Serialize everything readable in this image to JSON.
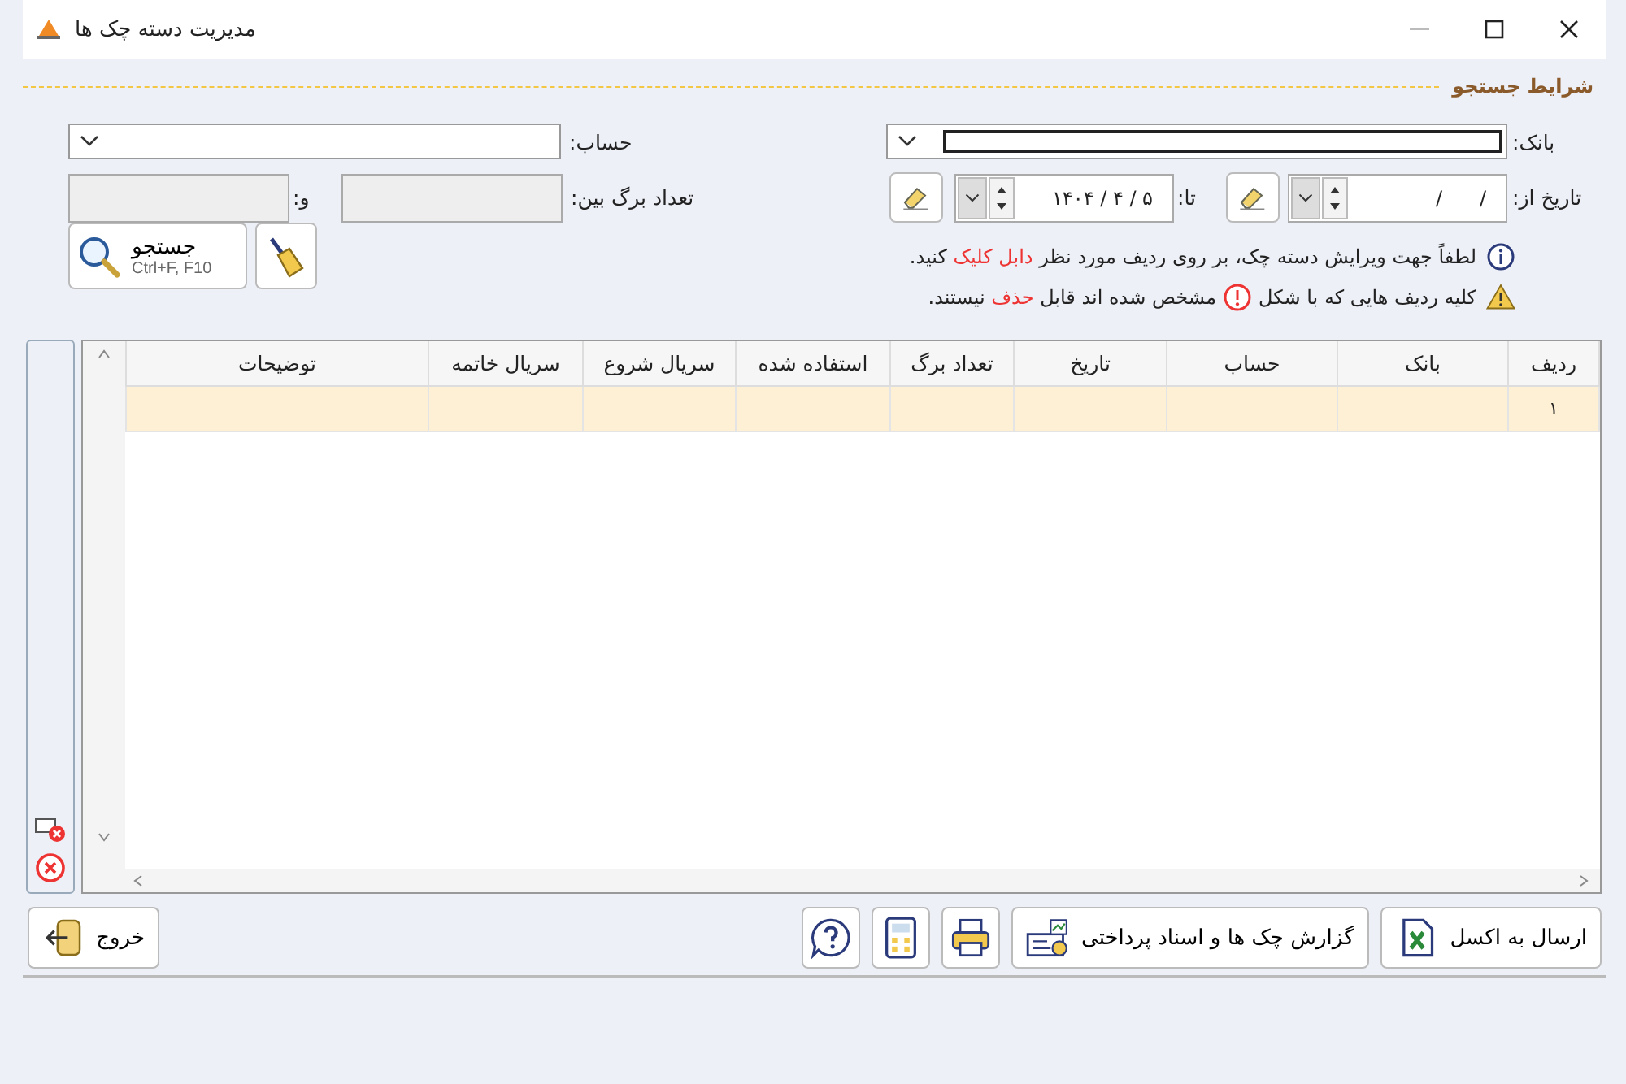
{
  "window": {
    "title": "مدیریت دسته چک ها"
  },
  "search_section": {
    "title": "شرایط جستجو",
    "bank": {
      "label": "بانک:"
    },
    "account": {
      "label": "حساب:"
    },
    "date_from": {
      "label": "تاریخ از:",
      "value": "/      /"
    },
    "date_to": {
      "label": "تا:",
      "value": "۱۴۰۴ / ۴ / ۵"
    },
    "sheet_count": {
      "label": "تعداد برگ بین:",
      "and_label": "و:"
    },
    "notes": [
      {
        "kind": "info",
        "parts": [
          {
            "kind": "text",
            "text": "لطفاً جهت ویرایش دسته چک، بر روی ردیف مورد نظر "
          },
          {
            "kind": "highlight",
            "text": "دابل کلیک"
          },
          {
            "kind": "text",
            "text": " کنید."
          }
        ]
      },
      {
        "kind": "warning",
        "parts": [
          {
            "kind": "text",
            "text": "کلیه ردیف هایی که با شکل"
          },
          {
            "kind": "icon"
          },
          {
            "kind": "text",
            "text": "مشخص شده اند قابل "
          },
          {
            "kind": "highlight",
            "text": "حذف"
          },
          {
            "kind": "text",
            "text": " نیستند."
          }
        ]
      }
    ],
    "search_button": {
      "label": "جستجو",
      "shortcut": "Ctrl+F, F10"
    }
  },
  "table": {
    "columns": [
      "ردیف",
      "بانک",
      "حساب",
      "تاریخ",
      "تعداد برگ",
      "استفاده شده",
      "سریال شروع",
      "سریال خاتمه",
      "توضیحات"
    ],
    "rows": [
      {
        "row_number": "۱",
        "selected": true
      }
    ]
  },
  "buttons": [
    {
      "kind": "excel",
      "label": "ارسال به اکسل"
    },
    {
      "kind": "report",
      "label": "گزارش چک ها و اسناد پرداختی"
    },
    {
      "kind": "print"
    },
    {
      "kind": "calculator"
    },
    {
      "kind": "help"
    }
  ],
  "exit_button": {
    "label": "خروج"
  }
}
